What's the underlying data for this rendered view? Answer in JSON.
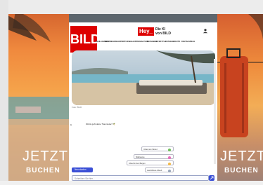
{
  "ad": {
    "left_line1": "JETZT",
    "left_line2": "BUCHEN",
    "right_line1": "JETZT",
    "right_line2": "BUCHEN"
  },
  "header": {
    "logo": "BILD",
    "hey_label": "Hey_",
    "hey_sub1": "Die KI",
    "hey_sub2": "von BILD"
  },
  "nav": {
    "items": [
      "SCHLAGZEILE",
      "NEWS",
      "REGIONAL",
      "SPORT",
      "FUSSBALL",
      "UNTERHALTUNG",
      "RATGEBER",
      "LIFESTYLE",
      "RATGEBER",
      "AUTO",
      "DIGITAL",
      "SPIELE"
    ]
  },
  "hero": {
    "caption": "Foto: BILD"
  },
  "chat": {
    "greeting": "Wohin geht deine Traumreise? 🌴",
    "suggestions": [
      {
        "label": "Urlaub am Strand",
        "icon": "palm-icon"
      },
      {
        "label": "Städtereise",
        "icon": "city-icon"
      },
      {
        "label": "Urlaub in den Bergen",
        "icon": "mountain-icon"
      },
      {
        "label": "Last-Minute-Urlaub",
        "icon": "plane-icon"
      }
    ],
    "new_chat": "Neu starten",
    "input_placeholder": "Schreiben Sie hier..."
  },
  "colors": {
    "brand": "#dd0000",
    "accent": "#3a4fd6"
  }
}
